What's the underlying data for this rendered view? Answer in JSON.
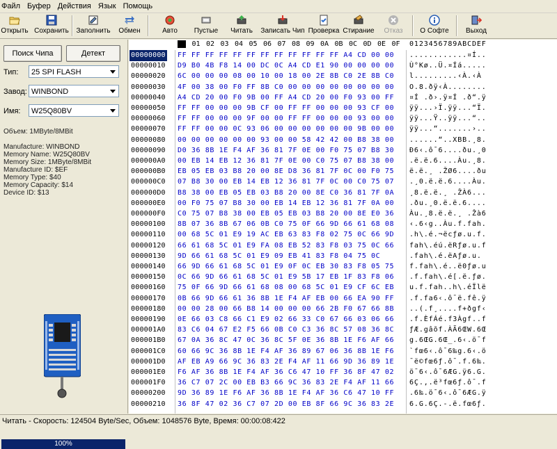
{
  "menu": [
    "Файл",
    "Буфер",
    "Действия",
    "Язык",
    "Помощь"
  ],
  "toolbar": [
    {
      "label": "Открыть",
      "icon": "open-folder-icon",
      "disabled": false
    },
    {
      "label": "Сохранить",
      "icon": "save-disk-icon",
      "disabled": false
    },
    {
      "label": "Заполнить",
      "icon": "fill-icon",
      "disabled": false
    },
    {
      "label": "Обмен",
      "icon": "swap-arrows-icon",
      "disabled": false
    },
    {
      "label": "Авто",
      "icon": "auto-icon",
      "disabled": false
    },
    {
      "label": "Пустые",
      "icon": "blank-check-icon",
      "disabled": false
    },
    {
      "label": "Читать",
      "icon": "read-chip-icon",
      "disabled": false
    },
    {
      "label": "Записать Чип",
      "icon": "write-chip-icon",
      "disabled": false
    },
    {
      "label": "Проверка",
      "icon": "verify-icon",
      "disabled": false
    },
    {
      "label": "Стирание",
      "icon": "erase-icon",
      "disabled": false
    },
    {
      "label": "Отказ",
      "icon": "cancel-icon",
      "disabled": true
    },
    {
      "label": "О Софте",
      "icon": "info-icon",
      "disabled": false
    },
    {
      "label": "Выход",
      "icon": "exit-icon",
      "disabled": false
    }
  ],
  "left": {
    "search_button": "Поиск Чипа",
    "detect_button": "Детект",
    "type_label": "Тип:",
    "type_value": "25 SPI FLASH",
    "vendor_label": "Завод:",
    "vendor_value": "WINBOND",
    "name_label": "Имя:",
    "name_value": "W25Q80BV",
    "volume": "Объем: 1MByte/8MBit",
    "info": [
      "Manufacture: WINBOND",
      "Memory Name: W25Q80BV",
      "Memory Size: 1MByte/8MBit",
      "Manufacture ID: $EF",
      "Memory Type: $40",
      "Memory Capacity: $14",
      "Device ID: $13"
    ],
    "progress_text": "100%",
    "progress_value": 1.0
  },
  "hex": {
    "header_cols": [
      "00",
      "01",
      "02",
      "03",
      "04",
      "05",
      "06",
      "07",
      "08",
      "09",
      "0A",
      "0B",
      "0C",
      "0D",
      "0E",
      "0F"
    ],
    "ascii_header": "0123456789ABCDEF",
    "rows": [
      {
        "addr": "00000000",
        "bytes": "FF FF FF FF FF FF FF FF FF FF FF FF A4 CD 00 00",
        "ascii": "............¤Í.."
      },
      {
        "addr": "00000010",
        "bytes": "D9 B0 4B F8 14 00 DC 0C A4 CD E1 90 00 00 00 00",
        "ascii": "Ù°Kø..Ü.¤Íá....."
      },
      {
        "addr": "00000020",
        "bytes": "6C 00 00 00 08 00 10 00 18 00 2E 8B C0 2E 8B C0",
        "ascii": "l.........‹À.‹À"
      },
      {
        "addr": "00000030",
        "bytes": "4F 00 38 00 F0 FF 8B C0 00 00 00 00 00 00 00 00",
        "ascii": "O.8.ðÿ‹À........"
      },
      {
        "addr": "00000040",
        "bytes": "A4 CD 20 00 F0 9B 00 FF A4 CD 20 00 F0 93 00 FF",
        "ascii": "¤Í .ð›.ÿ¤Í .ð“.ÿ"
      },
      {
        "addr": "00000050",
        "bytes": "FF FF 00 00 00 9B CF 00 FF FF 00 00 00 93 CF 00",
        "ascii": "ÿÿ...›Ï.ÿÿ...“Ï."
      },
      {
        "addr": "00000060",
        "bytes": "FF FF 00 00 00 9F 00 00 FF FF 00 00 00 93 00 00",
        "ascii": "ÿÿ...Ÿ..ÿÿ...“.."
      },
      {
        "addr": "00000070",
        "bytes": "FF FF 00 00 0C 93 06 00 00 00 00 00 00 9B 00 00",
        "ascii": "ÿÿ...“.......›.."
      },
      {
        "addr": "00000080",
        "bytes": "00 00 00 00 00 00 93 00 00 58 42 42 00 B8 38 00",
        "ascii": "......“..XBB.¸8."
      },
      {
        "addr": "00000090",
        "bytes": "D0 36 8B 1E F4 AF 36 81 7F 0E 00 F0 75 07 B8 30",
        "ascii": "Ð6‹.ô¯6....ðu.¸0"
      },
      {
        "addr": "000000A0",
        "bytes": "00 EB 14 EB 12 36 81 7F 0E 00 C0 75 07 B8 38 00",
        "ascii": ".ë.ë.6....Àu.¸8."
      },
      {
        "addr": "000000B0",
        "bytes": "EB 05 EB 03 B8 20 00 8E D8 36 81 7F 0C 00 F0 75",
        "ascii": "ë.ë.¸ .ŽØ6....ðu"
      },
      {
        "addr": "000000C0",
        "bytes": "07 B8 30 00 EB 14 EB 12 36 81 7F 0C 00 C0 75 07",
        "ascii": ".¸0.ë.ë.6....Àu."
      },
      {
        "addr": "000000D0",
        "bytes": "B8 38 00 EB 05 EB 03 B8 20 00 8E C0 36 81 7F 0A",
        "ascii": "¸8.ë.ë.¸ .ŽÀ6..."
      },
      {
        "addr": "000000E0",
        "bytes": "00 F0 75 07 B8 30 00 EB 14 EB 12 36 81 7F 0A 00",
        "ascii": ".ðu.¸0.ë.ë.6...."
      },
      {
        "addr": "000000F0",
        "bytes": "C0 75 07 B8 38 00 EB 05 EB 03 B8 20 00 8E E0 36",
        "ascii": "Àu.¸8.ë.ë.¸ .Žà6"
      },
      {
        "addr": "00000100",
        "bytes": "8B 07 36 8B 67 06 0B C0 75 0F 66 9D 66 61 68 08",
        "ascii": "‹.6‹g..Àu.f.fah."
      },
      {
        "addr": "00000110",
        "bytes": "00 68 5C 01 E9 19 AC EB 63 83 F8 02 75 0C 66 9D",
        "ascii": ".h\\.é.¬ëcƒø.u.f."
      },
      {
        "addr": "00000120",
        "bytes": "66 61 68 5C 01 E9 FA 08 EB 52 83 F8 03 75 0C 66",
        "ascii": "fah\\.éú.ëRƒø.u.f"
      },
      {
        "addr": "00000130",
        "bytes": "9D 66 61 68 5C 01 E9 09 EB 41 83 F8 04 75 0C",
        "ascii": ".fah\\.é.ëAƒø.u."
      },
      {
        "addr": "00000140",
        "bytes": "66 9D 66 61 68 5C 01 E9 0F 0C EB 30 83 F8 05 75",
        "ascii": "f.fah\\.é..ë0ƒø.u"
      },
      {
        "addr": "00000150",
        "bytes": "0C 66 9D 66 61 68 5C 01 E9 5B 17 EB 1F 83 F8 06",
        "ascii": ".f.fah\\.é[.ë.ƒø."
      },
      {
        "addr": "00000160",
        "bytes": "75 0F 66 9D 66 61 68 08 00 68 5C 01 E9 CF 6C EB",
        "ascii": "u.f.fah..h\\.éÏlë"
      },
      {
        "addr": "00000170",
        "bytes": "0B 66 9D 66 61 36 8B 1E F4 AF EB 00 66 EA 90 FF",
        "ascii": ".f.fa6‹.ô¯ë.fê.ÿ"
      },
      {
        "addr": "00000180",
        "bytes": "00 00 28 00 66 B8 14 00 00 00 66 2B F0 67 66 8B",
        "ascii": "..(.f¸....f+ðgf‹"
      },
      {
        "addr": "00000190",
        "bytes": "0E 66 03 C8 66 C1 E9 02 66 33 C0 67 66 03 06 66",
        "ascii": ".f.ÈfÁé.f3Àgf..f"
      },
      {
        "addr": "000001A0",
        "bytes": "83 C6 04 67 E2 F5 66 0B C0 C3 36 8C 57 08 36 8C",
        "ascii": "ƒÆ.gâõf.ÀÃ6ŒW.6Œ"
      },
      {
        "addr": "000001B0",
        "bytes": "67 0A 36 8C 47 0C 36 8C 5F 0E 36 8B 1E F6 AF 66",
        "ascii": "g.6ŒG.6Œ_.6‹.ö¯f"
      },
      {
        "addr": "000001C0",
        "bytes": "60 66 9C 36 8B 1E F4 AF 36 89 67 06 36 8B 1E F6",
        "ascii": "`fœ6‹.ô¯6‰g.6‹.ö"
      },
      {
        "addr": "000001D0",
        "bytes": "AF EB A9 66 9C 36 83 2E F4 AF 11 66 9D 36 89 1E",
        "ascii": "¯ë©fœ6ƒ.ô¯.f.6‰."
      },
      {
        "addr": "000001E0",
        "bytes": "F6 AF 36 8B 1E F4 AF 36 C6 47 10 FF 36 8F 47 02",
        "ascii": "ö¯6‹.ô¯6ÆG.ÿ6.G."
      },
      {
        "addr": "000001F0",
        "bytes": "36 C7 07 2C 00 EB B3 66 9C 36 83 2E F4 AF 11 66",
        "ascii": "6Ç.,.ë³fœ6ƒ.ô¯.f"
      },
      {
        "addr": "00000200",
        "bytes": "9D 36 89 1E F6 AF 36 8B 1E F4 AF 36 C6 47 10 FF",
        "ascii": ".6‰.ö¯6‹.ô¯6ÆG.ÿ"
      },
      {
        "addr": "00000210",
        "bytes": "36 8F 47 02 36 C7 07 2D 00 EB 8F 66 9C 36 83 2E",
        "ascii": "6.G.6Ç.-.ë.fœ6ƒ."
      }
    ]
  },
  "status": "Читать - Скорость: 124504 Byte/Sec, Объем: 1048576 Byte, Время: 00:00:08:422"
}
